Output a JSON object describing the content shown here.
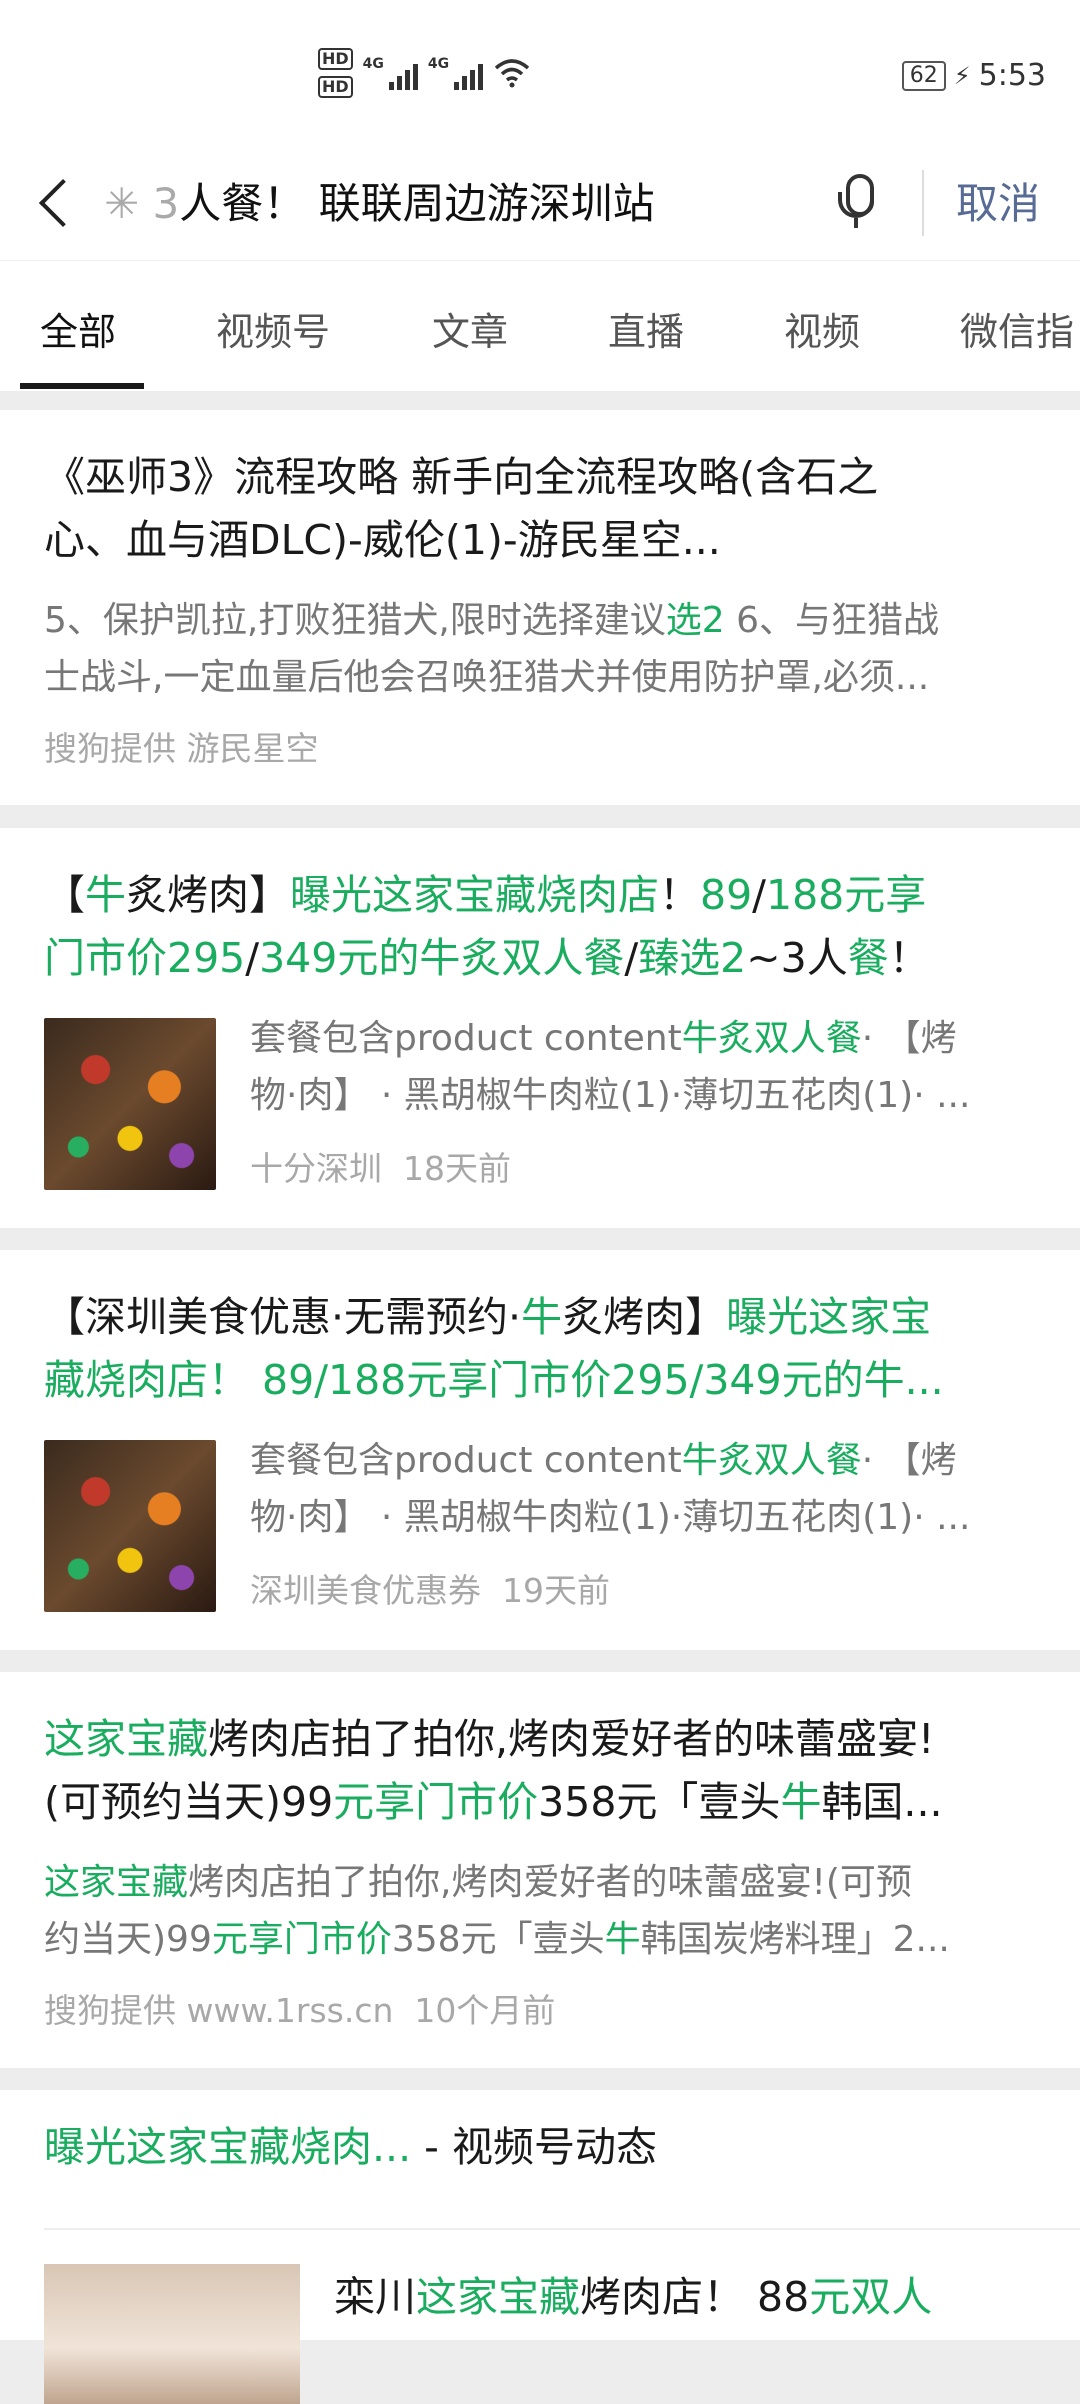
{
  "status": {
    "hd1": "HD",
    "hd2": "HD",
    "net1": "4G",
    "net2": "4G",
    "battery": "62",
    "time": "5:53"
  },
  "search": {
    "fade_prefix": "3",
    "query": "人餐！ 联联周边游深圳站",
    "cancel_label": "取消"
  },
  "tabs": [
    "全部",
    "视频号",
    "文章",
    "直播",
    "视频",
    "微信指"
  ],
  "results": [
    {
      "title_line1": "《巫师3》流程攻略 新手向全流程攻略(含石之",
      "title_line2": "心、血与酒DLC)-威伦(1)-游民星空...",
      "desc1_a": "5、保护凯拉,打败狂猎犬,限时选择建议",
      "desc1_hl": "选2",
      "desc1_b": " 6、与狂猎战",
      "desc2": "士战斗,一定血量后他会召唤狂猎犬并使用防护罩,必须...",
      "source": "搜狗提供 游民星空"
    },
    {
      "t1": [
        "【",
        "牛",
        "炙烤肉】",
        "曝光这家宝藏烧肉店",
        "！",
        "89",
        "/",
        "188元享"
      ],
      "t2": [
        "门市价295",
        "/",
        "349元的牛炙双人餐",
        "/",
        "臻选2",
        "~3人",
        "餐",
        "！"
      ],
      "desc1_a": "套餐包含product content",
      "desc1_hl": "牛炙双人餐",
      "desc1_b": "· 【烤",
      "desc2": "物·肉】 · 黑胡椒牛肉粒(1)·薄切五花肉(1)· ...",
      "account": "十分深圳",
      "time": "18天前"
    },
    {
      "t1_a": "【深圳美食优惠·无需预约·",
      "t1_hl1": "牛",
      "t1_b": "炙烤肉】",
      "t1_hl2": "曝光这家宝",
      "t2": "藏烧肉店！ 89/188元享门市价295/349元的牛...",
      "desc1_a": "套餐包含product content",
      "desc1_hl": "牛炙双人餐",
      "desc1_b": "· 【烤",
      "desc2": "物·肉】 · 黑胡椒牛肉粒(1)·薄切五花肉(1)· ...",
      "account": "深圳美食优惠券",
      "time": "19天前"
    },
    {
      "t1_hl": "这家宝藏",
      "t1_b": "烤肉店拍了拍你,烤肉爱好者的味蕾盛宴!",
      "t2_a": "(可预约当天)99",
      "t2_hl1": "元享门市价",
      "t2_b": "358元「壹头",
      "t2_hl2": "牛",
      "t2_c": "韩国...",
      "d1_hl": "这家宝藏",
      "d1_b": "烤肉店拍了拍你,烤肉爱好者的味蕾盛宴!(可预",
      "d2_a": "约当天)99",
      "d2_hl1": "元享门市价",
      "d2_b": "358元「壹头",
      "d2_hl2": "牛",
      "d2_c": "韩国炭烤料理」2...",
      "source": "搜狗提供 www.1rss.cn",
      "time": "10个月前"
    },
    {
      "header_hl": "曝光这家宝藏烧肉...",
      "header_b": " - 视频号动态",
      "item_a": "栾川",
      "item_hl1": "这家宝藏",
      "item_b": "烤肉店！ 88",
      "item_hl2": "元双人"
    }
  ]
}
